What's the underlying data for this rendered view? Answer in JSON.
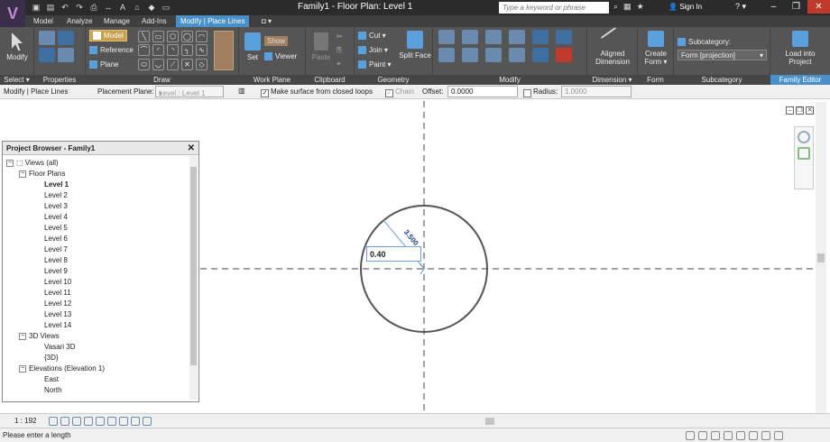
{
  "titlebar": {
    "title": "Family1 - Floor Plan: Level 1",
    "search_placeholder": "Type a keyword or phrase",
    "signin": "Sign In",
    "help": "? ▾"
  },
  "tabs": [
    "Model",
    "Analyze",
    "Manage",
    "Add-Ins",
    "Modify | Place Lines"
  ],
  "ribbon": {
    "select": {
      "modify": "Modify",
      "label": "Select ▾"
    },
    "properties": {
      "label": "Properties"
    },
    "draw": {
      "model": "Model",
      "reference": "Reference",
      "plane": "Plane",
      "label": "Draw"
    },
    "workplane": {
      "set": "Set",
      "show": "Show",
      "viewer": "Viewer",
      "label": "Work Plane"
    },
    "clipboard": {
      "paste": "Paste",
      "label": "Clipboard"
    },
    "geometry": {
      "cut": "Cut",
      "join": "Join",
      "paint": "Paint",
      "split_face": "Split Face",
      "label": "Geometry"
    },
    "modify": {
      "label": "Modify"
    },
    "dimension": {
      "aligned": "Aligned",
      "dimension": "Dimension",
      "label": "Dimension ▾"
    },
    "form": {
      "create": "Create",
      "form": "Form",
      "label": "Form"
    },
    "subcategory": {
      "title": "Subcategory:",
      "value": "Form [projection]",
      "label": "Subcategory"
    },
    "family_editor": {
      "load": "Load into",
      "project": "Project",
      "label": "Family Editor"
    }
  },
  "options": {
    "context": "Modify | Place Lines",
    "placement_plane_label": "Placement Plane:",
    "placement_plane_value": "Level : Level 1",
    "make_surface_label": "Make surface from closed loops",
    "make_surface_checked": "✓",
    "chain_label": "Chain",
    "chain_checked": "✓",
    "offset_label": "Offset:",
    "offset_value": "0.0000",
    "radius_label": "Radius:",
    "radius_value": "1.0000"
  },
  "canvas": {
    "radius_dimension": "3.500",
    "temp_input": "0.40"
  },
  "project_browser": {
    "title": "Project Browser - Family1",
    "close": "✕",
    "tree": [
      {
        "label": "Views (all)",
        "toggle": "−"
      },
      {
        "label": "Floor Plans",
        "toggle": "−"
      },
      {
        "label": "Level 1"
      },
      {
        "label": "Level 2"
      },
      {
        "label": "Level 3"
      },
      {
        "label": "Level 4"
      },
      {
        "label": "Level 5"
      },
      {
        "label": "Level 6"
      },
      {
        "label": "Level 7"
      },
      {
        "label": "Level 8"
      },
      {
        "label": "Level 9"
      },
      {
        "label": "Level 10"
      },
      {
        "label": "Level 11"
      },
      {
        "label": "Level 12"
      },
      {
        "label": "Level 13"
      },
      {
        "label": "Level 14"
      },
      {
        "label": "3D Views",
        "toggle": "−"
      },
      {
        "label": "Vasari 3D"
      },
      {
        "label": "{3D}"
      },
      {
        "label": "Elevations (Elevation 1)",
        "toggle": "−"
      },
      {
        "label": "East"
      },
      {
        "label": "North"
      }
    ]
  },
  "viewbar": {
    "scale": "1 : 192"
  },
  "status": {
    "text": "Please enter a length"
  }
}
